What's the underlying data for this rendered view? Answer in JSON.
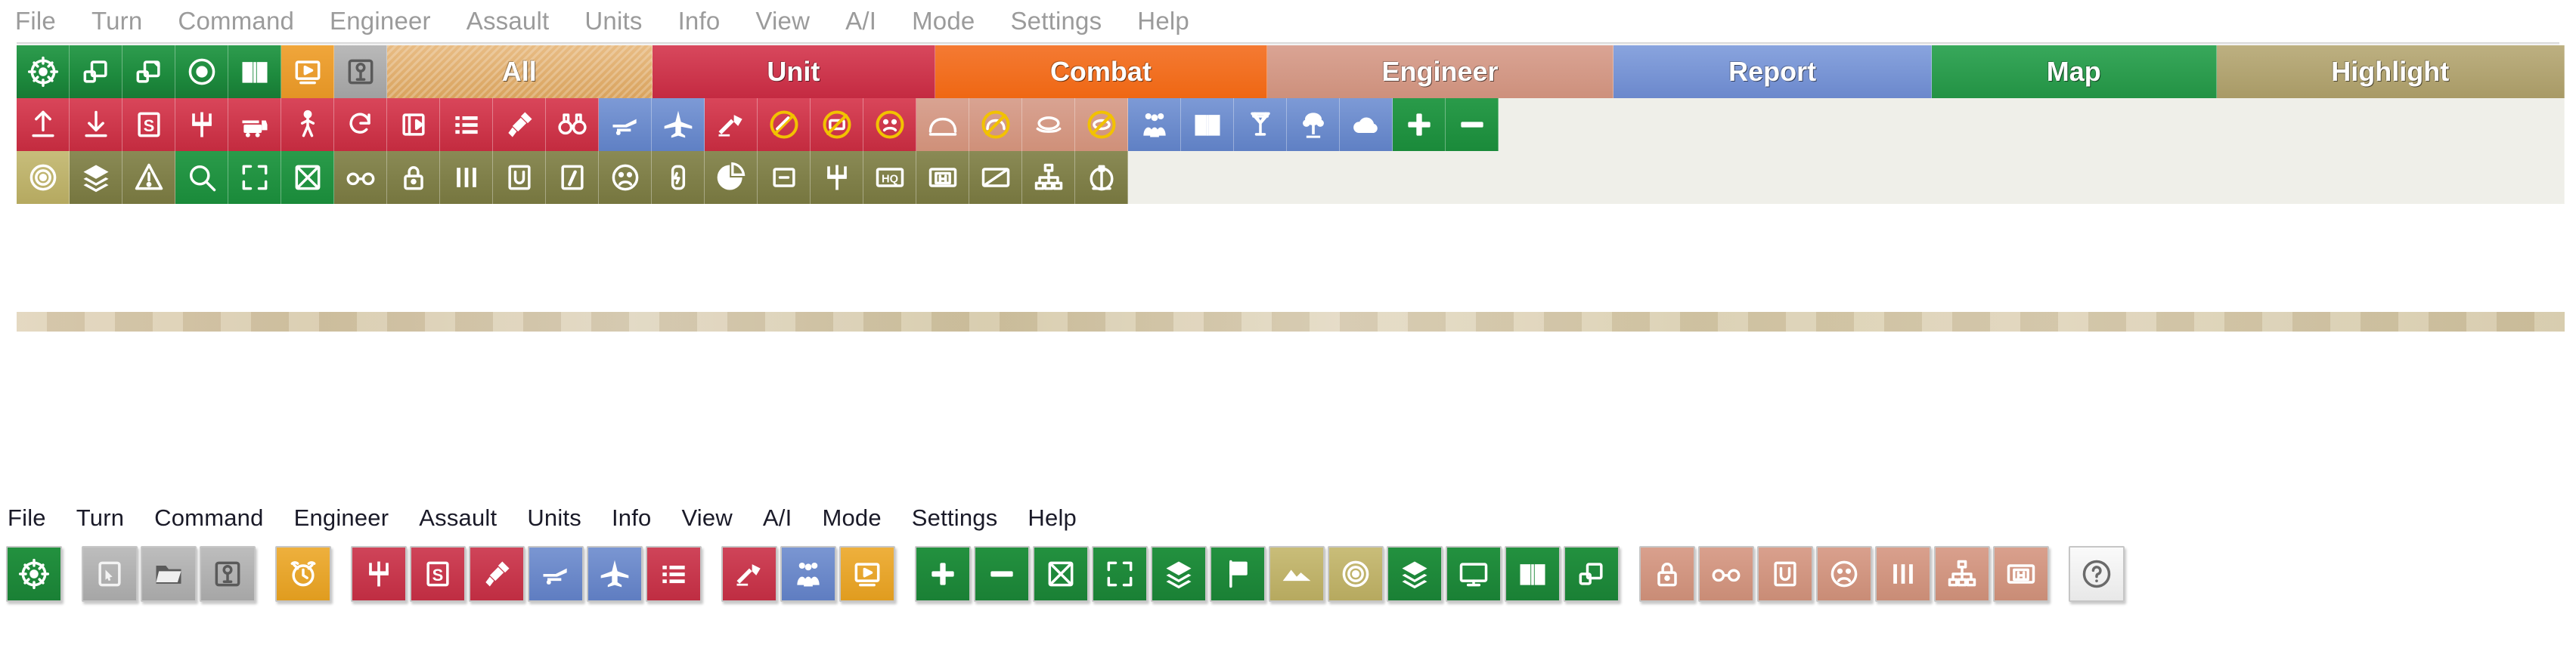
{
  "menus": {
    "top": [
      "File",
      "Turn",
      "Command",
      "Engineer",
      "Assault",
      "Units",
      "Info",
      "View",
      "A/I",
      "Mode",
      "Settings",
      "Help"
    ],
    "bottom": [
      "File",
      "Turn",
      "Command",
      "Engineer",
      "Assault",
      "Units",
      "Info",
      "View",
      "A/I",
      "Mode",
      "Settings",
      "Help"
    ]
  },
  "categories": [
    {
      "label": "All",
      "color": "#d9a35e",
      "style": "cat-all"
    },
    {
      "label": "Unit",
      "color": "#c42a41",
      "style": "cat-unit"
    },
    {
      "label": "Combat",
      "color": "#ef6713",
      "style": "cat-combat"
    },
    {
      "label": "Engineer",
      "color": "#cd907c",
      "style": "cat-engineer"
    },
    {
      "label": "Report",
      "color": "#6b88cc",
      "style": "cat-report"
    },
    {
      "label": "Map",
      "color": "#239244",
      "style": "cat-map"
    },
    {
      "label": "Highlight",
      "color": "#a89a66",
      "style": "cat-highlight"
    }
  ],
  "toolbar_rows": [
    {
      "name": "row-1-view-tools",
      "buttons": [
        {
          "icon": "crosshair-target-icon",
          "color": "green"
        },
        {
          "icon": "zoom-out-window-icon",
          "color": "green"
        },
        {
          "icon": "zoom-in-window-icon",
          "color": "green"
        },
        {
          "icon": "eye-visibility-icon",
          "color": "green"
        },
        {
          "icon": "open-book-map-icon",
          "color": "green"
        },
        {
          "icon": "play-screen-icon",
          "color": "orange"
        },
        {
          "icon": "save-disk-icon",
          "color": "grey"
        }
      ]
    },
    {
      "name": "row-2-unit-combat-engineer-report",
      "buttons": [
        {
          "icon": "arrow-up-deploy-icon",
          "color": "red"
        },
        {
          "icon": "arrow-down-withdraw-icon",
          "color": "red"
        },
        {
          "icon": "supply-s-icon",
          "color": "red"
        },
        {
          "icon": "trident-unit-icon",
          "color": "red"
        },
        {
          "icon": "train-rail-icon",
          "color": "red"
        },
        {
          "icon": "infantry-walk-icon",
          "color": "red"
        },
        {
          "icon": "rotate-reverse-icon",
          "color": "red"
        },
        {
          "icon": "unit-box-icon",
          "color": "red"
        },
        {
          "icon": "list-lines-icon",
          "color": "red"
        },
        {
          "icon": "entrench-shovel-icon",
          "color": "red"
        },
        {
          "icon": "binoculars-spot-icon",
          "color": "red"
        },
        {
          "icon": "artillery-gun-icon",
          "color": "blue"
        },
        {
          "icon": "aircraft-strike-icon",
          "color": "blue"
        },
        {
          "icon": "direct-fire-icon",
          "color": "red"
        },
        {
          "icon": "no-fire-icon",
          "color": "red"
        },
        {
          "icon": "no-rail-move-icon",
          "color": "red"
        },
        {
          "icon": "disrupted-face-icon",
          "color": "red"
        },
        {
          "icon": "bridge-arch-icon",
          "color": "salmon"
        },
        {
          "icon": "no-bridge-icon",
          "color": "salmon"
        },
        {
          "icon": "pontoon-icon",
          "color": "salmon"
        },
        {
          "icon": "no-pontoon-icon",
          "color": "salmon"
        },
        {
          "icon": "people-strength-icon",
          "color": "blue"
        },
        {
          "icon": "report-book-icon",
          "color": "blue"
        },
        {
          "icon": "victory-medal-icon",
          "color": "blue"
        },
        {
          "icon": "telephone-comms-icon",
          "color": "blue"
        },
        {
          "icon": "weather-cloud-icon",
          "color": "blue"
        },
        {
          "icon": "zoom-in-plus-icon",
          "color": "deepgreen"
        },
        {
          "icon": "zoom-out-minus-icon",
          "color": "deepgreen"
        }
      ]
    },
    {
      "name": "row-3-map-highlight",
      "buttons": [
        {
          "icon": "objective-target-icon",
          "color": "khaki"
        },
        {
          "icon": "layers-stack-icon",
          "color": "olive"
        },
        {
          "icon": "warning-alert-icon",
          "color": "olive"
        },
        {
          "icon": "magnifier-search-icon",
          "color": "deepgreen"
        },
        {
          "icon": "fit-screen-icon",
          "color": "deepgreen"
        },
        {
          "icon": "hex-grid-icon",
          "color": "deepgreen"
        },
        {
          "icon": "spectacles-view-icon",
          "color": "olive"
        },
        {
          "icon": "lock-icon",
          "color": "olive"
        },
        {
          "icon": "bars-strength-icon",
          "color": "olive"
        },
        {
          "icon": "unit-u-icon",
          "color": "olive"
        },
        {
          "icon": "info-i-icon",
          "color": "olive"
        },
        {
          "icon": "morale-face-icon",
          "color": "olive"
        },
        {
          "icon": "fuel-gauge-icon",
          "color": "olive"
        },
        {
          "icon": "pie-chart-icon",
          "color": "olive"
        },
        {
          "icon": "minimize-box-icon",
          "color": "olive"
        },
        {
          "icon": "trident-highlight-icon",
          "color": "olive"
        },
        {
          "icon": "hq-marker-icon",
          "color": "olive"
        },
        {
          "icon": "m-marker-icon",
          "color": "olive"
        },
        {
          "icon": "diagonal-slash-icon",
          "color": "olive"
        },
        {
          "icon": "org-chart-icon",
          "color": "olive"
        },
        {
          "icon": "bridge-tower-icon",
          "color": "olive"
        }
      ]
    }
  ],
  "bottom_toolbar": {
    "name": "compact-toolbar",
    "buttons": [
      {
        "icon": "crosshair-target-icon",
        "color": "green",
        "gap": true
      },
      {
        "icon": "new-file-icon",
        "color": "grey"
      },
      {
        "icon": "open-folder-icon",
        "color": "grey"
      },
      {
        "icon": "save-disk-icon",
        "color": "grey",
        "gap": true
      },
      {
        "icon": "alarm-clock-icon",
        "color": "amber",
        "gap": true
      },
      {
        "icon": "trident-unit-icon",
        "color": "red"
      },
      {
        "icon": "supply-s-icon",
        "color": "red"
      },
      {
        "icon": "entrench-shovel-icon",
        "color": "red"
      },
      {
        "icon": "artillery-gun-icon",
        "color": "blue"
      },
      {
        "icon": "aircraft-strike-icon",
        "color": "blue"
      },
      {
        "icon": "list-lines-icon",
        "color": "red",
        "gap": true
      },
      {
        "icon": "direct-fire-icon",
        "color": "red"
      },
      {
        "icon": "people-strength-icon",
        "color": "blue"
      },
      {
        "icon": "play-screen-icon",
        "color": "amber",
        "gap": true
      },
      {
        "icon": "zoom-in-plus-icon",
        "color": "green"
      },
      {
        "icon": "zoom-out-minus-icon",
        "color": "green"
      },
      {
        "icon": "hex-grid-icon",
        "color": "green"
      },
      {
        "icon": "fit-screen-icon",
        "color": "green"
      },
      {
        "icon": "layers-stack-icon",
        "color": "green"
      },
      {
        "icon": "flag-marker-icon",
        "color": "green"
      },
      {
        "icon": "terrain-hill-icon",
        "color": "khaki"
      },
      {
        "icon": "objective-target-icon",
        "color": "khaki"
      },
      {
        "icon": "layers-stack-icon",
        "color": "green"
      },
      {
        "icon": "screen-display-icon",
        "color": "green"
      },
      {
        "icon": "open-book-map-icon",
        "color": "green"
      },
      {
        "icon": "zoom-out-window-icon",
        "color": "green",
        "gap": true
      },
      {
        "icon": "lock-icon",
        "color": "salmon"
      },
      {
        "icon": "spectacles-view-icon",
        "color": "salmon"
      },
      {
        "icon": "unit-u-icon",
        "color": "salmon"
      },
      {
        "icon": "morale-face-icon",
        "color": "salmon"
      },
      {
        "icon": "bars-strength-icon",
        "color": "salmon"
      },
      {
        "icon": "org-chart-icon",
        "color": "salmon"
      },
      {
        "icon": "m-marker-icon",
        "color": "salmon",
        "gap": true
      },
      {
        "icon": "help-question-icon",
        "color": "white"
      }
    ]
  }
}
